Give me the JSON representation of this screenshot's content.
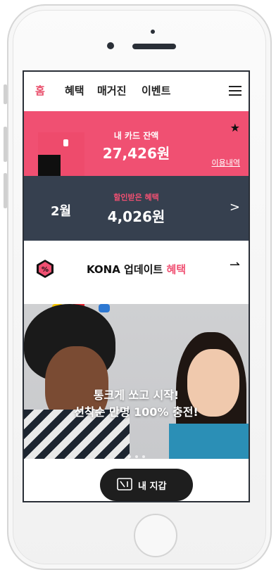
{
  "nav": {
    "tabs": [
      {
        "label": "홈"
      },
      {
        "label": "혜택"
      },
      {
        "label": "매거진"
      },
      {
        "label": "이벤트"
      }
    ]
  },
  "card": {
    "balance_label": "내 카드 잔액",
    "balance_value": "27,426원",
    "history_link": "이용내역"
  },
  "benefit": {
    "month": "2월",
    "discount_label": "할인받은 혜택",
    "discount_value": "4,026원"
  },
  "update": {
    "title_main": "KONA 업데이트 ",
    "title_highlight": "혜택",
    "icon_text": "%"
  },
  "banner": {
    "line1": "통크게 쏘고 시작!",
    "line2": "선착순 만명 100% 충전!"
  },
  "wallet": {
    "label": "내 지갑"
  },
  "colors": {
    "accent": "#f05072",
    "navy": "#36404f",
    "dark_button": "#1e1e1e"
  },
  "icons": [
    "menu-icon",
    "star-icon",
    "chevron-right-icon",
    "percent-icon",
    "arrow-right-icon",
    "wallet-icon"
  ]
}
